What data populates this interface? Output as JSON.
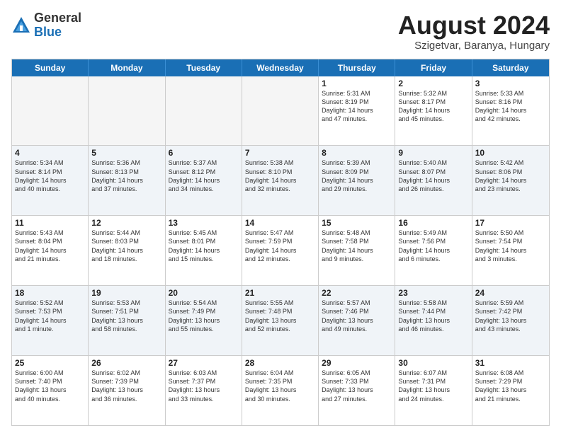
{
  "logo": {
    "general": "General",
    "blue": "Blue"
  },
  "header": {
    "month": "August 2024",
    "location": "Szigetvar, Baranya, Hungary"
  },
  "days_of_week": [
    "Sunday",
    "Monday",
    "Tuesday",
    "Wednesday",
    "Thursday",
    "Friday",
    "Saturday"
  ],
  "weeks": [
    [
      {
        "day": "",
        "text": ""
      },
      {
        "day": "",
        "text": ""
      },
      {
        "day": "",
        "text": ""
      },
      {
        "day": "",
        "text": ""
      },
      {
        "day": "1",
        "text": "Sunrise: 5:31 AM\nSunset: 8:19 PM\nDaylight: 14 hours\nand 47 minutes."
      },
      {
        "day": "2",
        "text": "Sunrise: 5:32 AM\nSunset: 8:17 PM\nDaylight: 14 hours\nand 45 minutes."
      },
      {
        "day": "3",
        "text": "Sunrise: 5:33 AM\nSunset: 8:16 PM\nDaylight: 14 hours\nand 42 minutes."
      }
    ],
    [
      {
        "day": "4",
        "text": "Sunrise: 5:34 AM\nSunset: 8:14 PM\nDaylight: 14 hours\nand 40 minutes."
      },
      {
        "day": "5",
        "text": "Sunrise: 5:36 AM\nSunset: 8:13 PM\nDaylight: 14 hours\nand 37 minutes."
      },
      {
        "day": "6",
        "text": "Sunrise: 5:37 AM\nSunset: 8:12 PM\nDaylight: 14 hours\nand 34 minutes."
      },
      {
        "day": "7",
        "text": "Sunrise: 5:38 AM\nSunset: 8:10 PM\nDaylight: 14 hours\nand 32 minutes."
      },
      {
        "day": "8",
        "text": "Sunrise: 5:39 AM\nSunset: 8:09 PM\nDaylight: 14 hours\nand 29 minutes."
      },
      {
        "day": "9",
        "text": "Sunrise: 5:40 AM\nSunset: 8:07 PM\nDaylight: 14 hours\nand 26 minutes."
      },
      {
        "day": "10",
        "text": "Sunrise: 5:42 AM\nSunset: 8:06 PM\nDaylight: 14 hours\nand 23 minutes."
      }
    ],
    [
      {
        "day": "11",
        "text": "Sunrise: 5:43 AM\nSunset: 8:04 PM\nDaylight: 14 hours\nand 21 minutes."
      },
      {
        "day": "12",
        "text": "Sunrise: 5:44 AM\nSunset: 8:03 PM\nDaylight: 14 hours\nand 18 minutes."
      },
      {
        "day": "13",
        "text": "Sunrise: 5:45 AM\nSunset: 8:01 PM\nDaylight: 14 hours\nand 15 minutes."
      },
      {
        "day": "14",
        "text": "Sunrise: 5:47 AM\nSunset: 7:59 PM\nDaylight: 14 hours\nand 12 minutes."
      },
      {
        "day": "15",
        "text": "Sunrise: 5:48 AM\nSunset: 7:58 PM\nDaylight: 14 hours\nand 9 minutes."
      },
      {
        "day": "16",
        "text": "Sunrise: 5:49 AM\nSunset: 7:56 PM\nDaylight: 14 hours\nand 6 minutes."
      },
      {
        "day": "17",
        "text": "Sunrise: 5:50 AM\nSunset: 7:54 PM\nDaylight: 14 hours\nand 3 minutes."
      }
    ],
    [
      {
        "day": "18",
        "text": "Sunrise: 5:52 AM\nSunset: 7:53 PM\nDaylight: 14 hours\nand 1 minute."
      },
      {
        "day": "19",
        "text": "Sunrise: 5:53 AM\nSunset: 7:51 PM\nDaylight: 13 hours\nand 58 minutes."
      },
      {
        "day": "20",
        "text": "Sunrise: 5:54 AM\nSunset: 7:49 PM\nDaylight: 13 hours\nand 55 minutes."
      },
      {
        "day": "21",
        "text": "Sunrise: 5:55 AM\nSunset: 7:48 PM\nDaylight: 13 hours\nand 52 minutes."
      },
      {
        "day": "22",
        "text": "Sunrise: 5:57 AM\nSunset: 7:46 PM\nDaylight: 13 hours\nand 49 minutes."
      },
      {
        "day": "23",
        "text": "Sunrise: 5:58 AM\nSunset: 7:44 PM\nDaylight: 13 hours\nand 46 minutes."
      },
      {
        "day": "24",
        "text": "Sunrise: 5:59 AM\nSunset: 7:42 PM\nDaylight: 13 hours\nand 43 minutes."
      }
    ],
    [
      {
        "day": "25",
        "text": "Sunrise: 6:00 AM\nSunset: 7:40 PM\nDaylight: 13 hours\nand 40 minutes."
      },
      {
        "day": "26",
        "text": "Sunrise: 6:02 AM\nSunset: 7:39 PM\nDaylight: 13 hours\nand 36 minutes."
      },
      {
        "day": "27",
        "text": "Sunrise: 6:03 AM\nSunset: 7:37 PM\nDaylight: 13 hours\nand 33 minutes."
      },
      {
        "day": "28",
        "text": "Sunrise: 6:04 AM\nSunset: 7:35 PM\nDaylight: 13 hours\nand 30 minutes."
      },
      {
        "day": "29",
        "text": "Sunrise: 6:05 AM\nSunset: 7:33 PM\nDaylight: 13 hours\nand 27 minutes."
      },
      {
        "day": "30",
        "text": "Sunrise: 6:07 AM\nSunset: 7:31 PM\nDaylight: 13 hours\nand 24 minutes."
      },
      {
        "day": "31",
        "text": "Sunrise: 6:08 AM\nSunset: 7:29 PM\nDaylight: 13 hours\nand 21 minutes."
      }
    ]
  ]
}
